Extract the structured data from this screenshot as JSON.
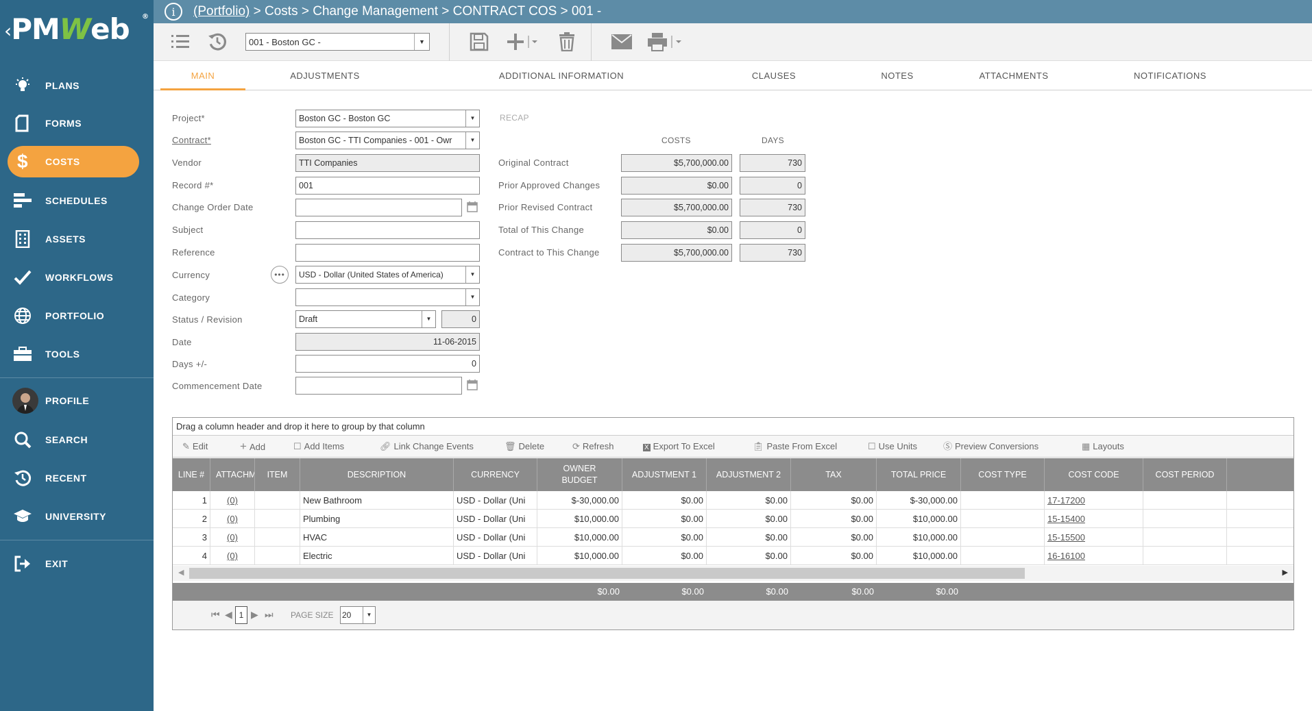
{
  "brand": {
    "name": "PMWeb"
  },
  "nav": [
    {
      "label": "PLANS",
      "icon": "lightbulb-icon"
    },
    {
      "label": "FORMS",
      "icon": "document-icon"
    },
    {
      "label": "COSTS",
      "icon": "dollar-icon"
    },
    {
      "label": "SCHEDULES",
      "icon": "schedule-bars-icon"
    },
    {
      "label": "ASSETS",
      "icon": "building-icon"
    },
    {
      "label": "WORKFLOWS",
      "icon": "checkmark-icon"
    },
    {
      "label": "PORTFOLIO",
      "icon": "globe-icon"
    },
    {
      "label": "TOOLS",
      "icon": "toolbox-icon"
    },
    {
      "label": "PROFILE",
      "icon": "avatar-icon"
    },
    {
      "label": "SEARCH",
      "icon": "search-icon"
    },
    {
      "label": "RECENT",
      "icon": "history-icon"
    },
    {
      "label": "UNIVERSITY",
      "icon": "graduation-cap-icon"
    },
    {
      "label": "EXIT",
      "icon": "exit-icon"
    }
  ],
  "active_nav": "COSTS",
  "breadcrumb": {
    "portfolio": "(Portfolio)",
    "rest": " > Costs > Change Management > CONTRACT COS > 001 -"
  },
  "record_selector": "001 - Boston GC -",
  "tabs": [
    "MAIN",
    "ADJUSTMENTS",
    "ADDITIONAL INFORMATION",
    "CLAUSES",
    "NOTES",
    "ATTACHMENTS",
    "NOTIFICATIONS"
  ],
  "active_tab": "MAIN",
  "form": {
    "project_label": "Project*",
    "project_value": "Boston GC - Boston GC",
    "contract_label": "Contract*",
    "contract_value": "Boston GC - TTI Companies - 001 - Owr",
    "vendor_label": "Vendor",
    "vendor_value": "TTI Companies",
    "record_label": "Record #*",
    "record_value": "001",
    "co_date_label": "Change Order Date",
    "co_date_value": "",
    "subject_label": "Subject",
    "subject_value": "",
    "reference_label": "Reference",
    "reference_value": "",
    "currency_label": "Currency",
    "currency_value": "USD - Dollar (United States of America)",
    "category_label": "Category",
    "category_value": "",
    "status_label": "Status / Revision",
    "status_value": "Draft",
    "revision_value": "0",
    "date_label": "Date",
    "date_value": "11-06-2015",
    "days_label": "Days +/-",
    "days_value": "0",
    "commencement_label": "Commencement Date",
    "commencement_value": ""
  },
  "recap": {
    "title": "RECAP",
    "costs_header": "COSTS",
    "days_header": "DAYS",
    "rows": [
      {
        "label": "Original Contract",
        "cost": "$5,700,000.00",
        "days": "730"
      },
      {
        "label": "Prior Approved Changes",
        "cost": "$0.00",
        "days": "0"
      },
      {
        "label": "Prior Revised Contract",
        "cost": "$5,700,000.00",
        "days": "730"
      },
      {
        "label": "Total of This Change",
        "cost": "$0.00",
        "days": "0"
      },
      {
        "label": "Contract to This Change",
        "cost": "$5,700,000.00",
        "days": "730"
      }
    ]
  },
  "grid": {
    "group_hint": "Drag a column header and drop it here to group by that column",
    "toolbar": [
      "Edit",
      "Add",
      "Add Items",
      "Link Change Events",
      "Delete",
      "Refresh",
      "Export To Excel",
      "Paste From Excel",
      "Use Units",
      "Preview Conversions",
      "Layouts"
    ],
    "columns": [
      "LINE #",
      "ATTACHMENTS",
      "ITEM",
      "DESCRIPTION",
      "CURRENCY",
      "OWNER BUDGET",
      "ADJUSTMENT 1",
      "ADJUSTMENT 2",
      "TAX",
      "TOTAL PRICE",
      "COST TYPE",
      "COST CODE",
      "COST PERIOD"
    ],
    "rows": [
      [
        "1",
        "(0)",
        "",
        "New Bathroom",
        "USD - Dollar (Uni",
        "$-30,000.00",
        "$0.00",
        "$0.00",
        "$0.00",
        "$-30,000.00",
        "",
        "17-17200",
        ""
      ],
      [
        "2",
        "(0)",
        "",
        "Plumbing",
        "USD - Dollar (Uni",
        "$10,000.00",
        "$0.00",
        "$0.00",
        "$0.00",
        "$10,000.00",
        "",
        "15-15400",
        ""
      ],
      [
        "3",
        "(0)",
        "",
        "HVAC",
        "USD - Dollar (Uni",
        "$10,000.00",
        "$0.00",
        "$0.00",
        "$0.00",
        "$10,000.00",
        "",
        "15-15500",
        ""
      ],
      [
        "4",
        "(0)",
        "",
        "Electric",
        "USD - Dollar (Uni",
        "$10,000.00",
        "$0.00",
        "$0.00",
        "$0.00",
        "$10,000.00",
        "",
        "16-16100",
        ""
      ]
    ],
    "totals": [
      "$0.00",
      "$0.00",
      "$0.00",
      "$0.00",
      "$0.00"
    ],
    "pager": {
      "page": "1",
      "page_size_label": "PAGE SIZE",
      "page_size": "20"
    }
  }
}
